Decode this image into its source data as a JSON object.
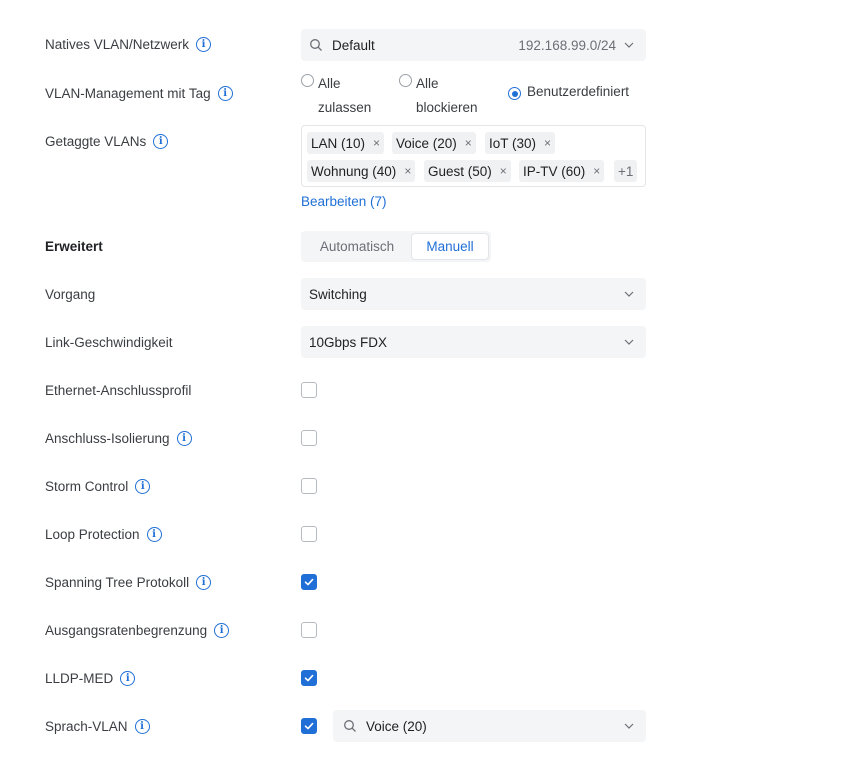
{
  "native_vlan": {
    "label": "Natives VLAN/Netzwerk",
    "value": "Default",
    "subnet": "192.168.99.0/24"
  },
  "vlan_management": {
    "label": "VLAN-Management mit Tag",
    "options": [
      {
        "line1": "Alle",
        "line2": "zulassen",
        "selected": false
      },
      {
        "line1": "Alle",
        "line2": "blockieren",
        "selected": false
      },
      {
        "line1": "Benutzerdefiniert",
        "line2": "",
        "selected": true
      }
    ]
  },
  "tagged_vlans": {
    "label": "Getaggte VLANs",
    "tags": [
      "LAN (10)",
      "Voice (20)",
      "IoT (30)",
      "Wohnung (40)",
      "Guest (50)",
      "IP-TV (60)"
    ],
    "remove_glyph": "×",
    "more": "+1",
    "edit_link": "Bearbeiten (7)"
  },
  "advanced": {
    "label": "Erweitert",
    "modes": [
      "Automatisch",
      "Manuell"
    ],
    "active_mode": "Manuell"
  },
  "operation": {
    "label": "Vorgang",
    "value": "Switching"
  },
  "link_speed": {
    "label": "Link-Geschwindigkeit",
    "value": "10Gbps FDX"
  },
  "settings": [
    {
      "label": "Ethernet-Anschlussprofil",
      "info": false,
      "checked": false
    },
    {
      "label": "Anschluss-Isolierung",
      "info": true,
      "checked": false
    },
    {
      "label": "Storm Control",
      "info": true,
      "checked": false
    },
    {
      "label": "Loop Protection",
      "info": true,
      "checked": false
    },
    {
      "label": "Spanning Tree Protokoll",
      "info": true,
      "checked": true
    },
    {
      "label": "Ausgangsratenbegrenzung",
      "info": true,
      "checked": false
    },
    {
      "label": "LLDP-MED",
      "info": true,
      "checked": true
    },
    {
      "label": "Sprach-VLAN",
      "info": true,
      "checked": true
    }
  ],
  "voice_vlan_select": {
    "value": "Voice (20)"
  },
  "info_glyph": "i",
  "colors": {
    "accent": "#1f6fd6",
    "field_bg": "#f4f5f6",
    "text": "#3a3d42"
  }
}
